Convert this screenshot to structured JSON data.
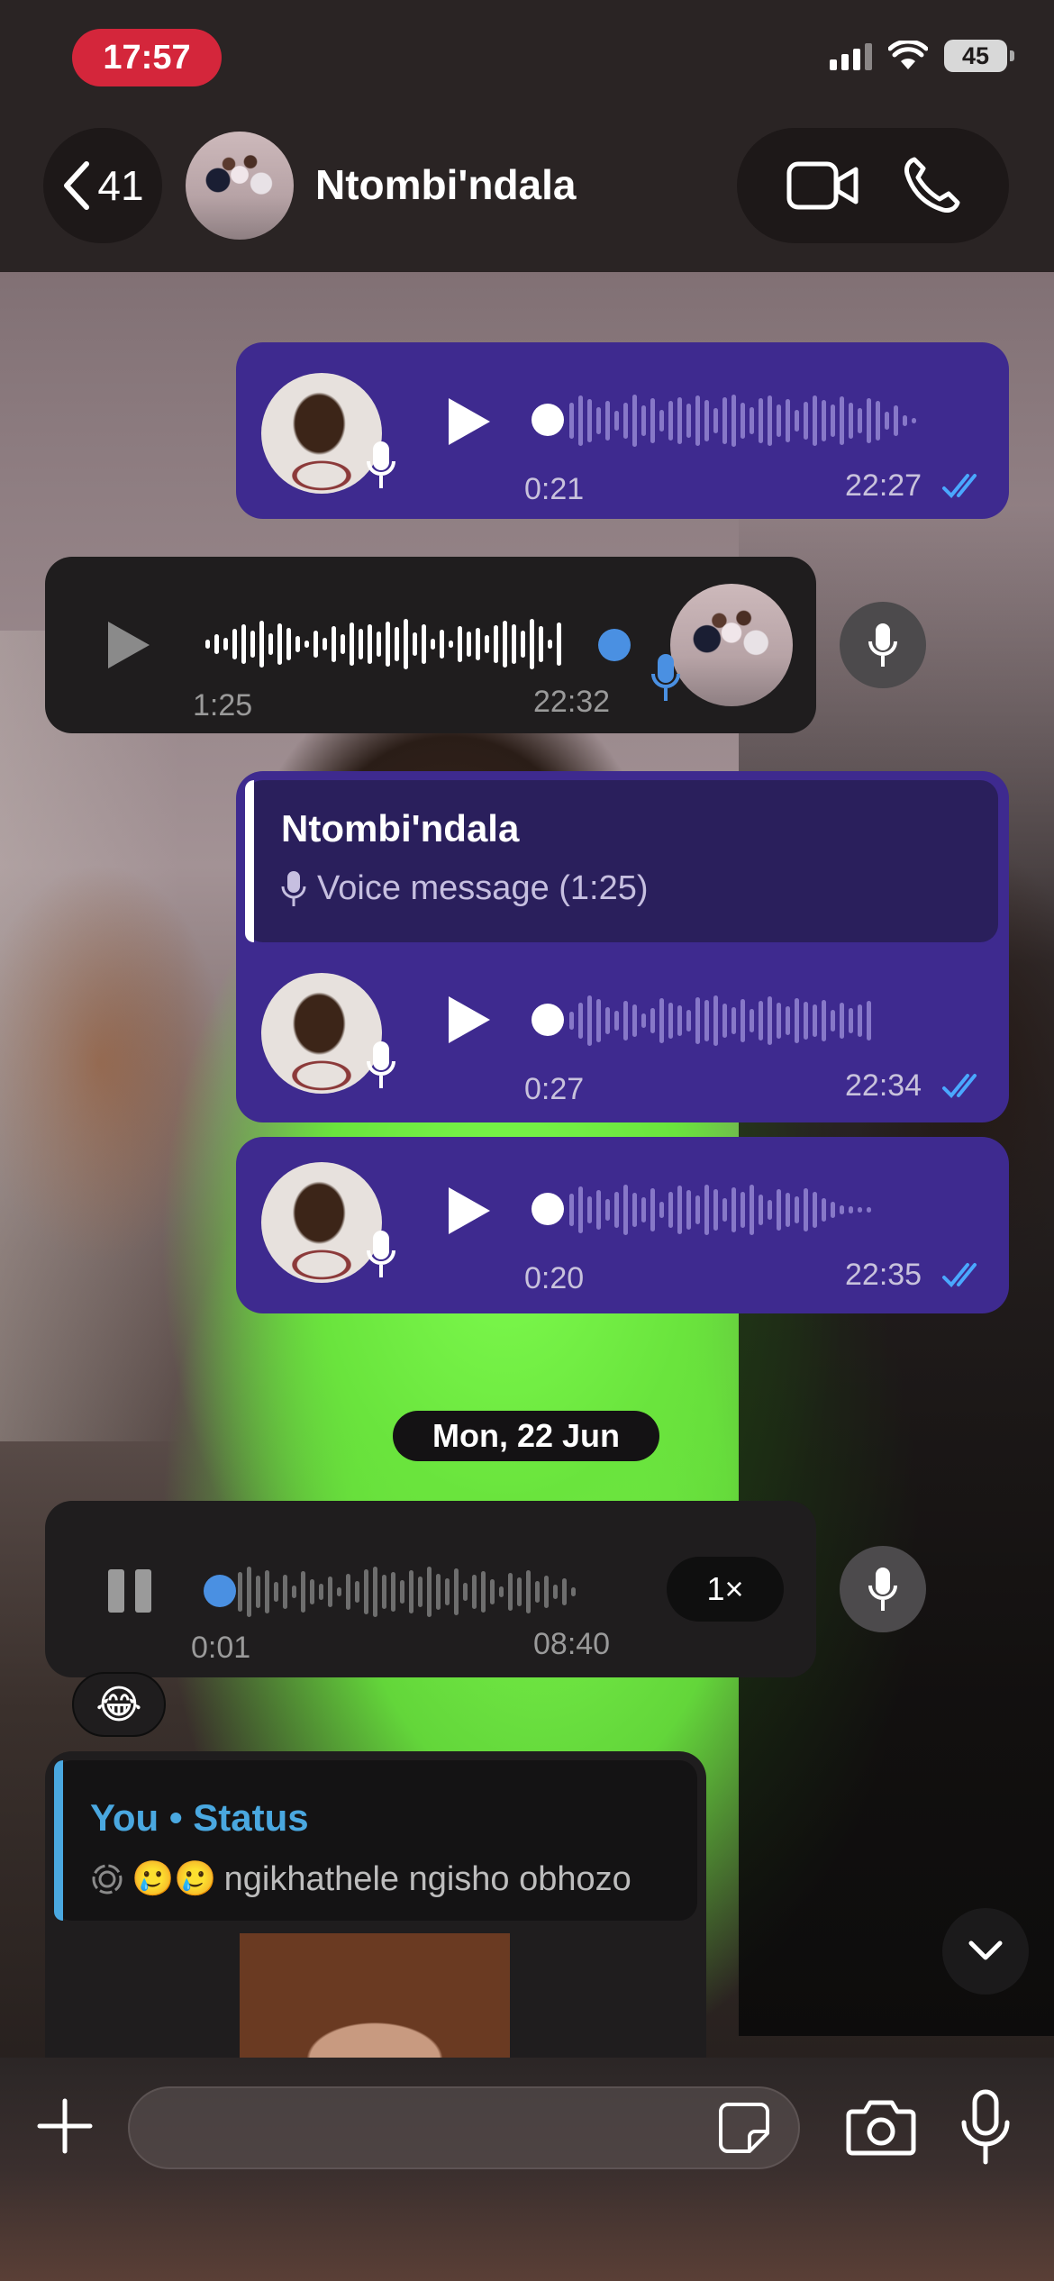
{
  "status_bar": {
    "time": "17:57",
    "battery": "45"
  },
  "header": {
    "back_count": "41",
    "contact_name": "Ntombi'ndala"
  },
  "messages": {
    "out1": {
      "duration": "0:21",
      "timestamp": "22:27"
    },
    "in1": {
      "duration": "1:25",
      "timestamp": "22:32"
    },
    "out2": {
      "reply_name": "Ntombi'ndala",
      "reply_text": "Voice message (1:25)",
      "duration": "0:27",
      "timestamp": "22:34"
    },
    "out3": {
      "duration": "0:20",
      "timestamp": "22:35"
    },
    "date_separator": "Mon, 22 Jun",
    "in2": {
      "duration": "0:01",
      "timestamp": "08:40",
      "speed": "1×",
      "reaction": "😂"
    },
    "in3": {
      "status_title": "You • Status",
      "status_text": "ngikhathele ngisho obhozo",
      "status_emojis": "🥲🥲"
    }
  },
  "composer": {
    "placeholder": ""
  },
  "colors": {
    "outgoing_bubble": "#3e2a8f",
    "incoming_bubble": "#1f1d1e",
    "accent_blue": "#4a90e2",
    "time_pill": "#d4263b"
  }
}
